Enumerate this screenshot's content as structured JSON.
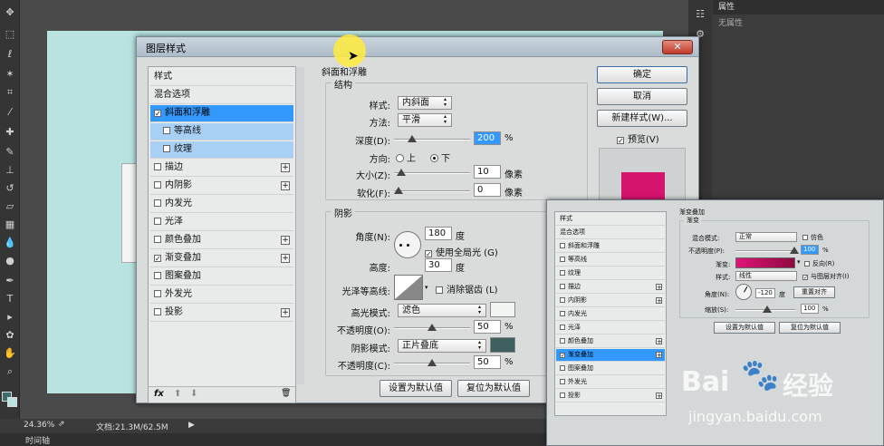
{
  "app": {
    "zoom": "24.36%",
    "doc_info": "文档:21.3M/62.5M",
    "timeline_label": "时间轴"
  },
  "properties_panel": {
    "title": "属性",
    "empty_text": "无属性"
  },
  "dialog": {
    "title": "图层样式",
    "close_symbol": "✕",
    "styles_list": [
      {
        "label": "样式",
        "checkbox": false,
        "checked": false,
        "plus": false,
        "state": "normal"
      },
      {
        "label": "混合选项",
        "checkbox": false,
        "checked": false,
        "plus": false,
        "state": "normal"
      },
      {
        "label": "斜面和浮雕",
        "checkbox": true,
        "checked": true,
        "plus": false,
        "state": "selected"
      },
      {
        "label": "等高线",
        "checkbox": true,
        "checked": false,
        "plus": false,
        "state": "sub"
      },
      {
        "label": "纹理",
        "checkbox": true,
        "checked": false,
        "plus": false,
        "state": "sub"
      },
      {
        "label": "描边",
        "checkbox": true,
        "checked": false,
        "plus": true,
        "state": "normal"
      },
      {
        "label": "内阴影",
        "checkbox": true,
        "checked": false,
        "plus": true,
        "state": "normal"
      },
      {
        "label": "内发光",
        "checkbox": true,
        "checked": false,
        "plus": false,
        "state": "normal"
      },
      {
        "label": "光泽",
        "checkbox": true,
        "checked": false,
        "plus": false,
        "state": "normal"
      },
      {
        "label": "颜色叠加",
        "checkbox": true,
        "checked": false,
        "plus": true,
        "state": "normal"
      },
      {
        "label": "渐变叠加",
        "checkbox": true,
        "checked": true,
        "plus": true,
        "state": "normal"
      },
      {
        "label": "图案叠加",
        "checkbox": true,
        "checked": false,
        "plus": false,
        "state": "normal"
      },
      {
        "label": "外发光",
        "checkbox": true,
        "checked": false,
        "plus": false,
        "state": "normal"
      },
      {
        "label": "投影",
        "checkbox": true,
        "checked": false,
        "plus": true,
        "state": "normal"
      }
    ],
    "list_footer": {
      "fx": "fx",
      "up": "⬆",
      "down": "⬇",
      "trash": "🗑"
    },
    "bevel": {
      "section_title": "斜面和浮雕",
      "structure_title": "结构",
      "style_label": "样式:",
      "style_value": "内斜面",
      "technique_label": "方法:",
      "technique_value": "平滑",
      "depth_label": "深度(D):",
      "depth_value": "200",
      "depth_slider": 0.2,
      "percent": "%",
      "direction_label": "方向:",
      "dir_up": "上",
      "dir_down": "下",
      "size_label": "大小(Z):",
      "size_value": "10",
      "size_slider": 0.04,
      "soften_label": "软化(F):",
      "soften_value": "0",
      "soften_slider": 0.0,
      "px": "像素"
    },
    "shading": {
      "title": "阴影",
      "angle_label": "角度(N):",
      "angle_value": "180",
      "deg": "度",
      "global_light": "使用全局光 (G)",
      "altitude_label": "高度:",
      "altitude_value": "30",
      "gloss_label": "光泽等高线:",
      "anti_alias": "消除锯齿 (L)",
      "highlight_mode_label": "高光模式:",
      "highlight_mode_value": "滤色",
      "highlight_color": "#f2f4f2",
      "highlight_opacity_label": "不透明度(O):",
      "highlight_opacity_value": "50",
      "highlight_opacity_slider": 0.5,
      "shadow_mode_label": "阴影模式:",
      "shadow_mode_value": "正片叠底",
      "shadow_color": "#3d5f5e",
      "shadow_opacity_label": "不透明度(C):",
      "shadow_opacity_value": "50",
      "shadow_opacity_slider": 0.5,
      "percent": "%"
    },
    "defaults": {
      "set_default": "设置为默认值",
      "reset_default": "复位为默认值"
    },
    "buttons": {
      "ok": "确定",
      "cancel": "取消",
      "new_style": "新建样式(W)...",
      "preview": "预览(V)"
    },
    "preview_color": "#d6146e"
  },
  "dialog2": {
    "styles_list": [
      {
        "label": "样式",
        "checkbox": false,
        "checked": false,
        "plus": false,
        "state": "normal"
      },
      {
        "label": "混合选项",
        "checkbox": false,
        "checked": false,
        "plus": false,
        "state": "normal"
      },
      {
        "label": "斜面和浮雕",
        "checkbox": true,
        "checked": false,
        "plus": false,
        "state": "normal"
      },
      {
        "label": "等高线",
        "checkbox": true,
        "checked": false,
        "plus": false,
        "state": "normal"
      },
      {
        "label": "纹理",
        "checkbox": true,
        "checked": false,
        "plus": false,
        "state": "normal"
      },
      {
        "label": "描边",
        "checkbox": true,
        "checked": false,
        "plus": true,
        "state": "normal"
      },
      {
        "label": "内阴影",
        "checkbox": true,
        "checked": false,
        "plus": true,
        "state": "normal"
      },
      {
        "label": "内发光",
        "checkbox": true,
        "checked": false,
        "plus": false,
        "state": "normal"
      },
      {
        "label": "光泽",
        "checkbox": true,
        "checked": false,
        "plus": false,
        "state": "normal"
      },
      {
        "label": "颜色叠加",
        "checkbox": true,
        "checked": false,
        "plus": true,
        "state": "normal"
      },
      {
        "label": "渐变叠加",
        "checkbox": true,
        "checked": true,
        "plus": true,
        "state": "selected"
      },
      {
        "label": "图案叠加",
        "checkbox": true,
        "checked": false,
        "plus": false,
        "state": "normal"
      },
      {
        "label": "外发光",
        "checkbox": true,
        "checked": false,
        "plus": false,
        "state": "normal"
      },
      {
        "label": "投影",
        "checkbox": true,
        "checked": false,
        "plus": true,
        "state": "normal"
      }
    ],
    "section_title": "渐变叠加",
    "sub_title": "渐变",
    "blend_label": "混合模式:",
    "blend_value": "正常",
    "dither": "仿色",
    "opacity_label": "不透明度(P):",
    "opacity_value": "100",
    "percent": "%",
    "gradient_label": "渐变:",
    "reverse": "反向(R)",
    "style_label": "样式:",
    "style_value": "线性",
    "align_layer": "与图层对齐(I)",
    "angle_label": "角度(N):",
    "angle_value": "-120",
    "deg": "度",
    "reset_align": "重置对齐",
    "scale_label": "缩放(S):",
    "scale_value": "100",
    "set_default": "设置为默认值",
    "reset_default": "复位为默认值",
    "gradient_from": "#e0147a",
    "gradient_to": "#8e0a3e"
  },
  "watermark": {
    "brand": "Bai",
    "brand2": "经验",
    "url": "jingyan.baidu.com"
  }
}
